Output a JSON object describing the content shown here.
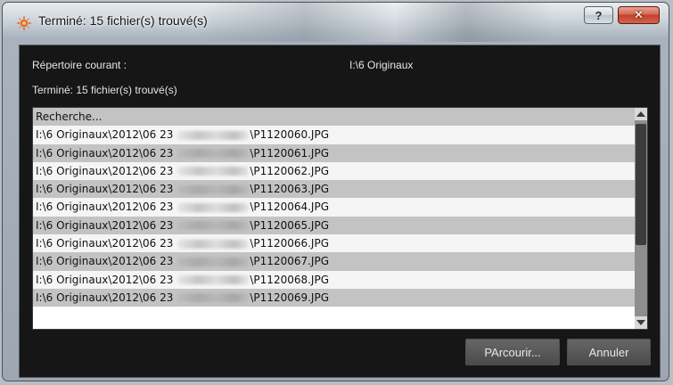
{
  "window": {
    "title": "Terminé: 15 fichier(s) trouvé(s)",
    "help_label": "?",
    "close_label": "✕"
  },
  "info": {
    "current_dir_label": "Répertoire courant :",
    "current_dir_value": "I:\\6 Originaux",
    "status": "Terminé: 15 fichier(s) trouvé(s)"
  },
  "list": {
    "header": "Recherche...",
    "rows": [
      {
        "prefix": "I:\\6 Originaux\\2012\\06 23",
        "file": "\\P1120060.JPG"
      },
      {
        "prefix": "I:\\6 Originaux\\2012\\06 23",
        "file": "\\P1120061.JPG"
      },
      {
        "prefix": "I:\\6 Originaux\\2012\\06 23",
        "file": "\\P1120062.JPG"
      },
      {
        "prefix": "I:\\6 Originaux\\2012\\06 23",
        "file": "\\P1120063.JPG"
      },
      {
        "prefix": "I:\\6 Originaux\\2012\\06 23",
        "file": "\\P1120064.JPG"
      },
      {
        "prefix": "I:\\6 Originaux\\2012\\06 23",
        "file": "\\P1120065.JPG"
      },
      {
        "prefix": "I:\\6 Originaux\\2012\\06 23",
        "file": "\\P1120066.JPG"
      },
      {
        "prefix": "I:\\6 Originaux\\2012\\06 23",
        "file": "\\P1120067.JPG"
      },
      {
        "prefix": "I:\\6 Originaux\\2012\\06 23",
        "file": "\\P1120068.JPG"
      },
      {
        "prefix": "I:\\6 Originaux\\2012\\06 23",
        "file": "\\P1120069.JPG"
      }
    ]
  },
  "buttons": {
    "browse_label": "PArcourir...",
    "cancel_label": "Annuler"
  },
  "colors": {
    "client_bg": "#161616",
    "row_light": "#f5f5f5",
    "row_dark": "#c3c3c3",
    "close_red": "#c0412a"
  },
  "icons": {
    "app": "app-sunburst-icon",
    "help": "help-icon",
    "close": "close-icon",
    "scroll_up": "arrow-up-icon",
    "scroll_down": "arrow-down-icon"
  }
}
